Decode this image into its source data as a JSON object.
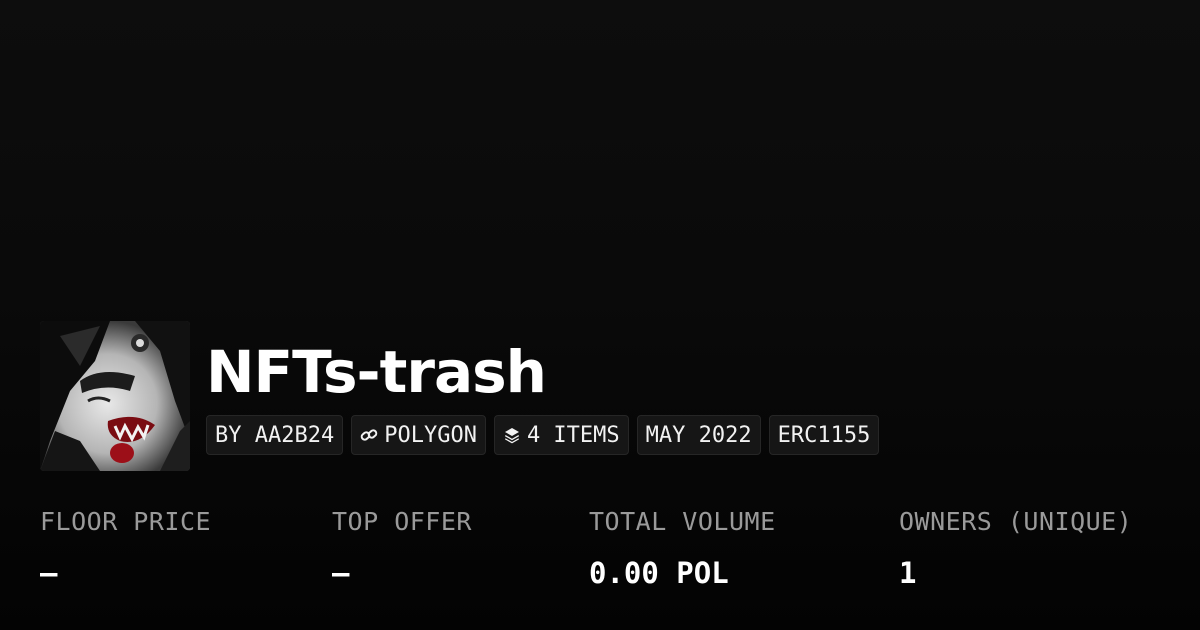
{
  "collection": {
    "name": "NFTs-trash",
    "badges": {
      "creator": "BY AA2B24",
      "chain": "POLYGON",
      "items": "4 ITEMS",
      "date": "MAY 2022",
      "standard": "ERC1155"
    }
  },
  "stats": [
    {
      "label": "FLOOR PRICE",
      "value": "–"
    },
    {
      "label": "TOP OFFER",
      "value": "–"
    },
    {
      "label": "TOTAL VOLUME",
      "value": "0.00 POL"
    },
    {
      "label": "OWNERS (UNIQUE)",
      "value": "1"
    }
  ],
  "icons": {
    "chain": "link-icon",
    "items": "layers-icon"
  },
  "colors": {
    "background": "#0a0a0a",
    "badge_background": "#161616",
    "label": "#9a9a9a",
    "text": "#ffffff"
  }
}
